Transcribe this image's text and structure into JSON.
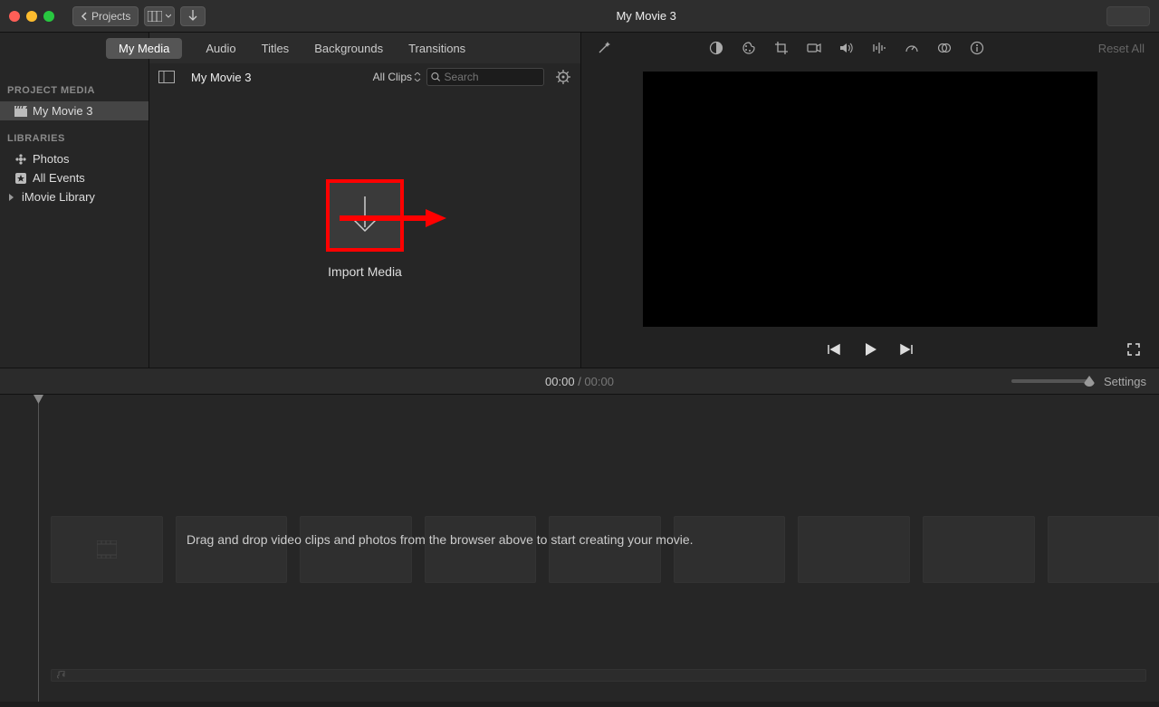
{
  "window": {
    "title": "My Movie 3"
  },
  "titlebar": {
    "back_label": "Projects"
  },
  "tabs": {
    "my_media": "My Media",
    "audio": "Audio",
    "titles": "Titles",
    "backgrounds": "Backgrounds",
    "transitions": "Transitions"
  },
  "sidebar": {
    "project_media_head": "PROJECT MEDIA",
    "project_name": "My Movie 3",
    "libraries_head": "LIBRARIES",
    "photos": "Photos",
    "all_events": "All Events",
    "imovie_library": "iMovie Library"
  },
  "browser": {
    "title": "My Movie 3",
    "filter": "All Clips",
    "search_placeholder": "Search",
    "import_label": "Import Media"
  },
  "viewer": {
    "reset": "Reset All"
  },
  "timeline": {
    "current": "00:00",
    "duration": "00:00",
    "settings": "Settings",
    "hint": "Drag and drop video clips and photos from the browser above to start creating your movie."
  }
}
